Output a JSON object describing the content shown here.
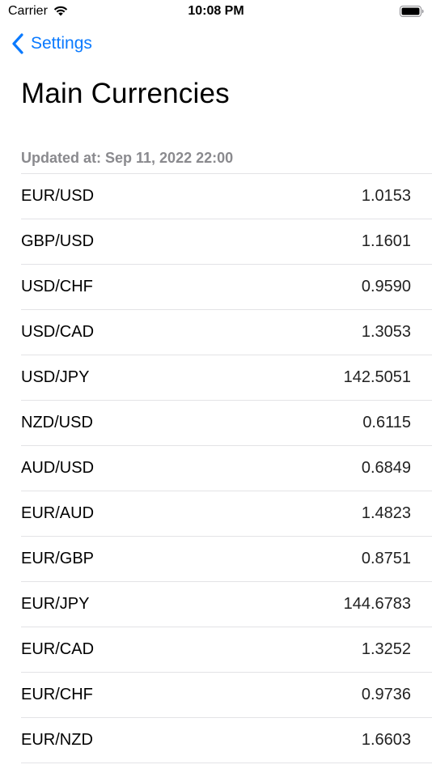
{
  "status_bar": {
    "carrier": "Carrier",
    "time": "10:08 PM"
  },
  "nav": {
    "back_label": "Settings"
  },
  "page": {
    "title": "Main Currencies",
    "updated_label": "Updated at: Sep 11, 2022 22:00"
  },
  "rates": [
    {
      "pair": "EUR/USD",
      "rate": "1.0153"
    },
    {
      "pair": "GBP/USD",
      "rate": "1.1601"
    },
    {
      "pair": "USD/CHF",
      "rate": "0.9590"
    },
    {
      "pair": "USD/CAD",
      "rate": "1.3053"
    },
    {
      "pair": "USD/JPY",
      "rate": "142.5051"
    },
    {
      "pair": "NZD/USD",
      "rate": "0.6115"
    },
    {
      "pair": "AUD/USD",
      "rate": "0.6849"
    },
    {
      "pair": "EUR/AUD",
      "rate": "1.4823"
    },
    {
      "pair": "EUR/GBP",
      "rate": "0.8751"
    },
    {
      "pair": "EUR/JPY",
      "rate": "144.6783"
    },
    {
      "pair": "EUR/CAD",
      "rate": "1.3252"
    },
    {
      "pair": "EUR/CHF",
      "rate": "0.9736"
    },
    {
      "pair": "EUR/NZD",
      "rate": "1.6603"
    }
  ],
  "icons": {
    "wifi": "wifi-icon",
    "battery": "battery-icon",
    "back": "chevron-left-icon"
  },
  "colors": {
    "accent": "#0a7aff",
    "secondary_text": "#8a8a8e",
    "separator": "#e3e3e6"
  }
}
